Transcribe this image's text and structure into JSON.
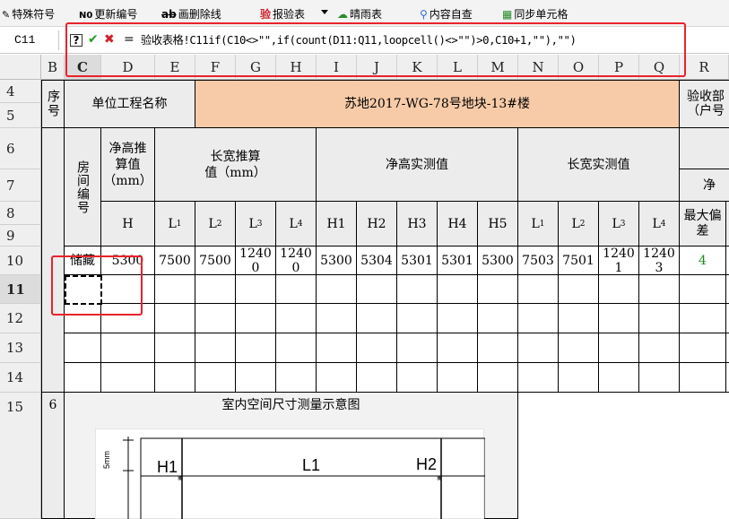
{
  "toolbar": {
    "special_chars": "特殊符号",
    "renumber": "更新编号",
    "strikethrough": "画删除线",
    "report": "报验表",
    "report_icon": "验",
    "weather": "晴雨表",
    "self_check": "内容自查",
    "sync_cells": "同步单元格"
  },
  "formula_bar": {
    "cell_ref": "C11",
    "prefix": "=",
    "formula": "验收表格!C11if(C10<>\"\",if(count(D11:Q11,loopcell()<>\"\")>0,C10+1,\"\"),\"\")"
  },
  "columns": [
    "B",
    "C",
    "D",
    "E",
    "F",
    "G",
    "H",
    "I",
    "J",
    "K",
    "L",
    "M",
    "N",
    "O",
    "P",
    "Q",
    "R"
  ],
  "rows": [
    "4",
    "5",
    "6",
    "7",
    "8",
    "9",
    "10",
    "11",
    "12",
    "13",
    "14",
    "15"
  ],
  "table": {
    "seq_header": "序号",
    "unit_name_label": "单位工程名称",
    "unit_name_value": "苏地2017-WG-78号地块-13#楼",
    "acceptance_label": "验收部",
    "household_label": "（户号",
    "room_no_header": "房间编号",
    "net_height_est_header": "净高推算值（mm）",
    "lw_est_header": "长宽推算值（mm）",
    "net_height_meas_header": "净高实测值",
    "lw_meas_header": "长宽实测值",
    "net_partial": "净",
    "max_dev_header": "最大偏差",
    "sub_h": "H",
    "sub_l1": "L",
    "sub_l2": "L",
    "sub_l3": "L",
    "sub_l4": "L",
    "idx1": "1",
    "idx2": "2",
    "idx3": "3",
    "idx4": "4",
    "sub_h1": "H1",
    "sub_h2": "H2",
    "sub_h3": "H3",
    "sub_h4": "H4",
    "sub_h5": "H5",
    "meas_l1": "L",
    "meas_l2": "L",
    "meas_l3": "L",
    "meas_l4": "L",
    "row10": {
      "room": "储藏",
      "h_est": "5300",
      "l1": "7500",
      "l2": "7500",
      "l3": "12400",
      "l4": "12400",
      "h1": "5300",
      "h2": "5304",
      "h3": "5301",
      "h4": "5301",
      "h5": "5300",
      "ml1": "7503",
      "ml2": "7501",
      "ml3": "12401",
      "ml4": "12403",
      "max_dev": "4"
    },
    "section6_no": "6",
    "section6_title": "室内空间尺寸测量示意图"
  },
  "sketch": {
    "dim": "5mm",
    "h1": "H1",
    "l1": "L1",
    "h2": "H2"
  }
}
